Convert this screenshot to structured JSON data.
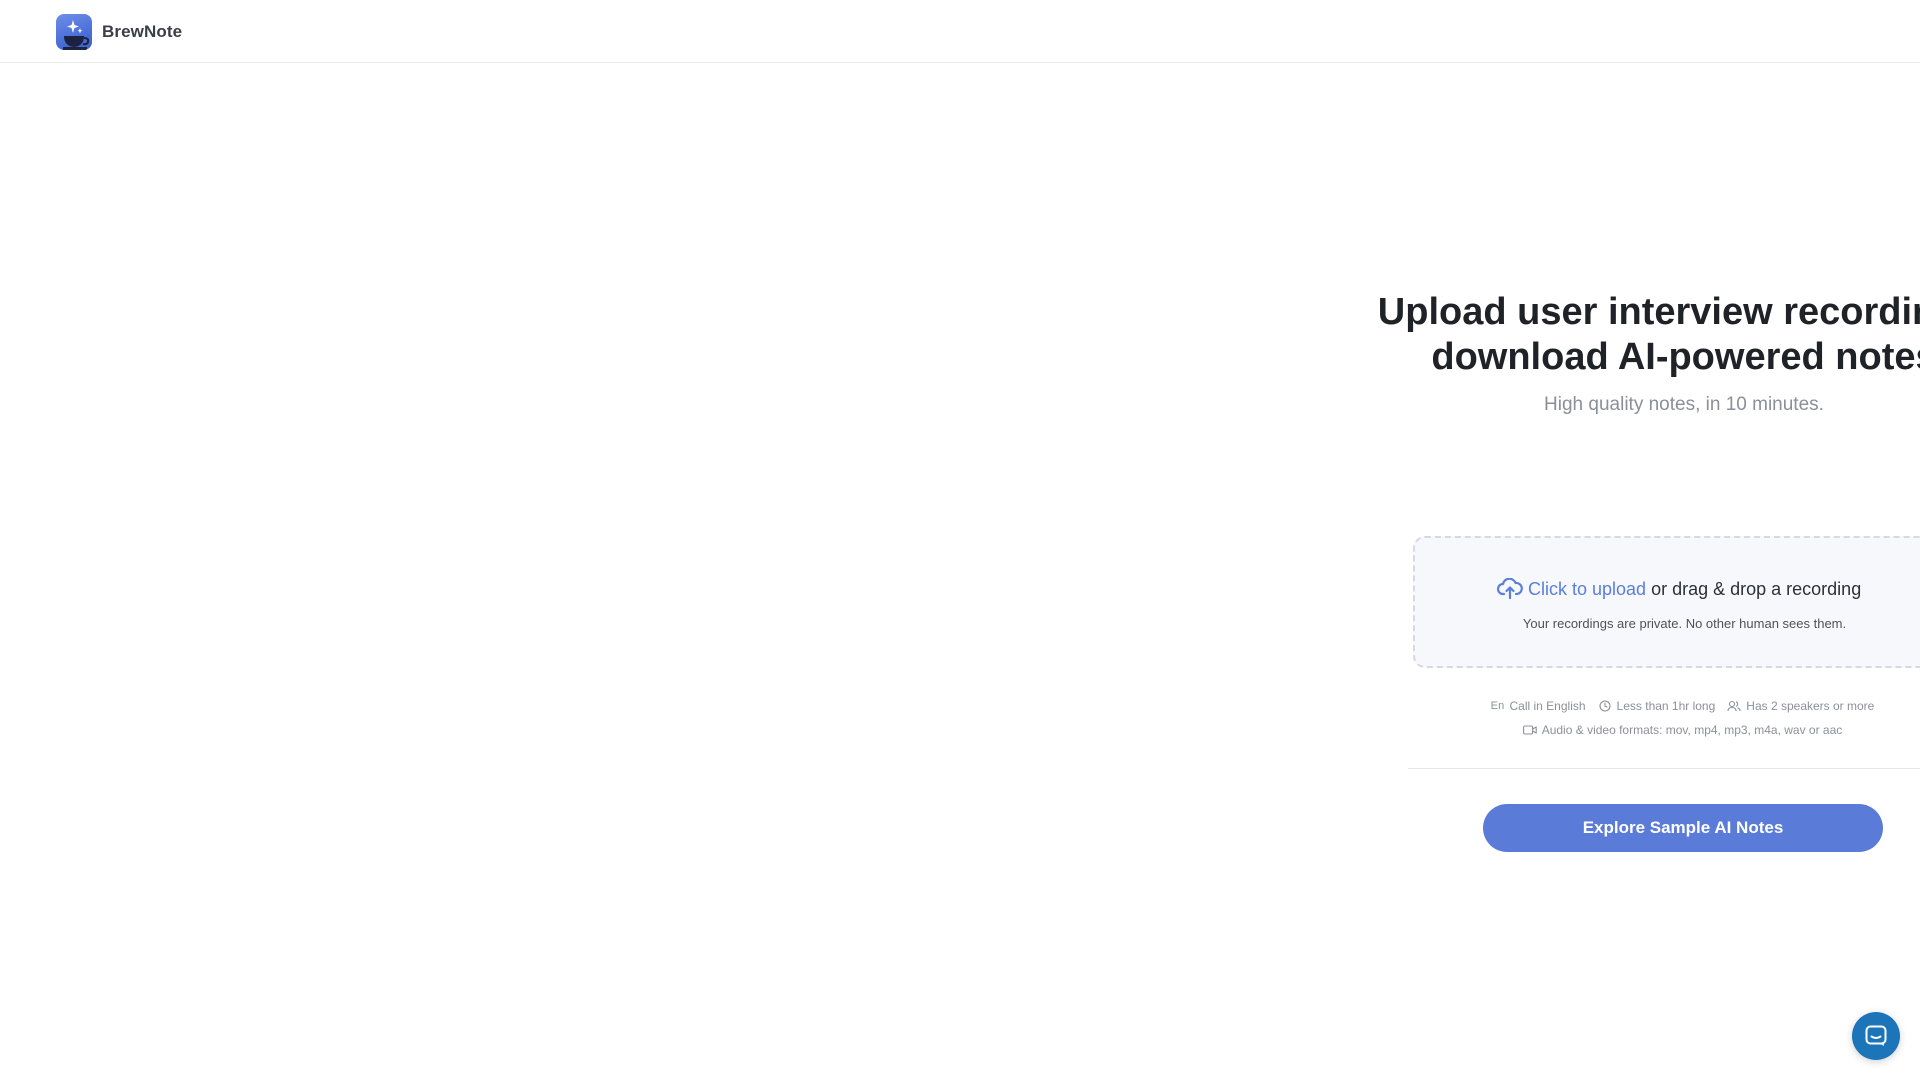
{
  "brand": {
    "name": "BrewNote",
    "logo_icon": "brewnote-logo-icon"
  },
  "hero": {
    "title_line1": "Upload user interview recordings,",
    "title_line2": "download AI-powered notes",
    "subtitle": "High quality notes, in 10 minutes."
  },
  "upload": {
    "icon": "cloud-upload-icon",
    "click_label": "Click to upload",
    "rest_label": "or drag & drop a recording",
    "privacy_note": "Your recordings are private. No other human sees them."
  },
  "requirements": {
    "language_badge": "En",
    "language": "Call in English",
    "duration": "Less than 1hr long",
    "speakers": "Has 2 speakers or more",
    "formats": "Audio & video formats: mov, mp4, mp3, m4a, wav or aac"
  },
  "cta": {
    "explore_label": "Explore Sample AI Notes"
  },
  "chat": {
    "icon": "chat-bubble-icon"
  },
  "colors": {
    "accent": "#5b7bd8",
    "link": "#5a7fd8",
    "chat": "#1c74b9"
  }
}
